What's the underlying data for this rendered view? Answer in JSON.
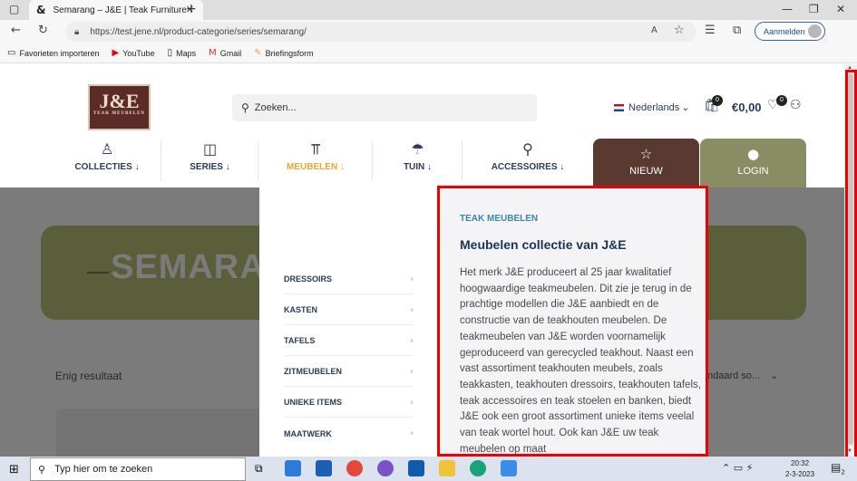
{
  "browser": {
    "tab_title": "Semarang – J&E | Teak Furniture",
    "url": "https://test.jene.nl/product-categorie/series/semarang/",
    "signin_label": "Aanmelden",
    "bookmarks": [
      {
        "label": "Favorieten importeren",
        "icon": "folder-icon"
      },
      {
        "label": "YouTube",
        "icon": "youtube-icon"
      },
      {
        "label": "Maps",
        "icon": "maps-icon"
      },
      {
        "label": "Gmail",
        "icon": "gmail-icon"
      },
      {
        "label": "Briefingsform",
        "icon": "form-icon"
      }
    ]
  },
  "header": {
    "logo_text": "J&E",
    "logo_subtext": "TEAK MEUBELEN",
    "search_placeholder": "Zoeken...",
    "language": "Nederlands",
    "cart_count": "0",
    "cart_total": "€0,00",
    "wishlist_count": "0"
  },
  "nav": {
    "items": [
      {
        "label": "COLLECTIES",
        "arrow": "↓"
      },
      {
        "label": "SERIES",
        "arrow": "↓"
      },
      {
        "label": "MEUBELEN",
        "arrow": "↓"
      },
      {
        "label": "TUIN",
        "arrow": "↓"
      },
      {
        "label": "ACCESSOIRES",
        "arrow": "↓"
      }
    ],
    "nieuw": "NIEUW",
    "login": "LOGIN",
    "active_color": "#e8a736"
  },
  "mega": {
    "submenu": [
      "DRESSOIRS",
      "KASTEN",
      "TAFELS",
      "ZITMEUBELEN",
      "UNIEKE ITEMS",
      "MAATWERK"
    ],
    "kicker": "TEAK MEUBELEN",
    "title": "Meubelen collectie van J&E",
    "text": "Het merk J&E produceert al 25 jaar kwalitatief hoogwaardige teakmeubelen. Dit zie je terug in de prachtige modellen die J&E aanbiedt en de constructie van de teakhouten meubelen. De teakmeubelen van J&E worden voornamelijk geproduceerd van gerecycled teakhout. Naast een vast assortiment teakhouten meubels, zoals teakkasten, teakhouten dressoirs, teakhouten tafels, teak accessoires en teak stoelen en banken, biedt J&E ook een groot assortiment unieke items veelal van teak wortel hout. Ook kan J&E uw teak meubelen op maat"
  },
  "content": {
    "hero_title": "SEMARANG",
    "result_count": "Enig resultaat",
    "sort_label": "ndaard so..."
  },
  "taskbar": {
    "search_placeholder": "Typ hier om te zoeken",
    "time": "20:32",
    "date": "2-3-2023",
    "notifications": "2"
  }
}
